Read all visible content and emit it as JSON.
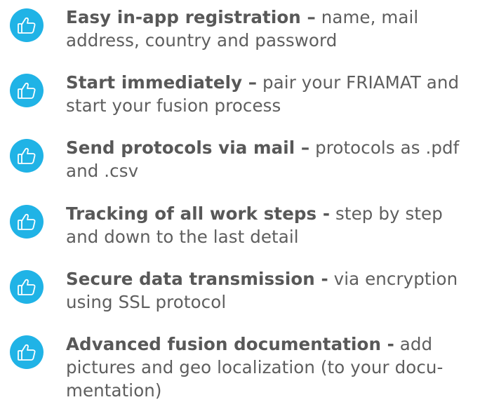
{
  "features": [
    {
      "icon": "thumbs-up-icon",
      "title": "Easy in-app registration –",
      "description": "name, mail address, country and password"
    },
    {
      "icon": "thumbs-up-icon",
      "title": "Start immediately –",
      "description": "pair your FRIAMAT and start your fusion process"
    },
    {
      "icon": "thumbs-up-icon",
      "title": "Send protocols via mail –",
      "description": "protocols as .pdf and .csv"
    },
    {
      "icon": "thumbs-up-icon",
      "title": "Tracking of all work steps -",
      "description": "step by step and down to the last detail"
    },
    {
      "icon": "thumbs-up-icon",
      "title": "Secure data transmission -",
      "description": "via encryption using SSL protocol"
    },
    {
      "icon": "thumbs-up-icon",
      "title": "Advanced fusion documentation -",
      "description": "add pictures and geo localization (to your docu-mentation)"
    }
  ],
  "colors": {
    "icon_background": "#20b3e6",
    "icon_stroke": "#ffffff",
    "text": "#595959"
  }
}
